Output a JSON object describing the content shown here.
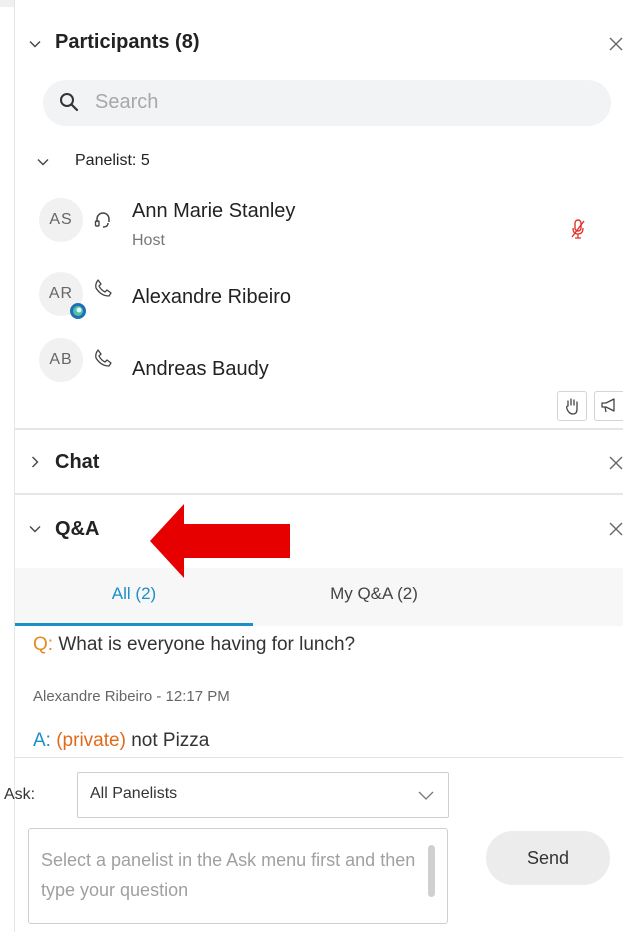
{
  "participants": {
    "title": "Participants (8)",
    "search_placeholder": "Search",
    "group_label": "Panelist: 5",
    "list": [
      {
        "initials": "AS",
        "name": "Ann Marie Stanley",
        "role": "Host",
        "device": "headset-icon",
        "muted": true
      },
      {
        "initials": "AR",
        "name": "Alexandre Ribeiro",
        "role": "",
        "device": "phone-icon",
        "muted": false
      },
      {
        "initials": "AB",
        "name": "Andreas Baudy",
        "role": "",
        "device": "phone-icon",
        "muted": false
      }
    ]
  },
  "chat": {
    "title": "Chat"
  },
  "qa": {
    "title": "Q&A",
    "tabs": [
      {
        "label": "All (2)",
        "active": true
      },
      {
        "label": "My Q&A (2)",
        "active": false
      }
    ],
    "question_prefix": "Q:",
    "question_text": " What is everyone having for lunch?",
    "meta": "Alexandre Ribeiro - 12:17 PM",
    "answer_prefix": "A:",
    "answer_private": "(private)",
    "answer_text": " not Pizza",
    "ask_label": "Ask:",
    "ask_value": "All Panelists",
    "input_placeholder": "Select a panelist in the Ask menu first and then type your question",
    "send_label": "Send"
  },
  "colors": {
    "accent": "#1a8fc8",
    "question": "#e58a1f",
    "private": "#e06a1a",
    "muted_mic": "#e0332a",
    "arrow": "#e60000"
  }
}
